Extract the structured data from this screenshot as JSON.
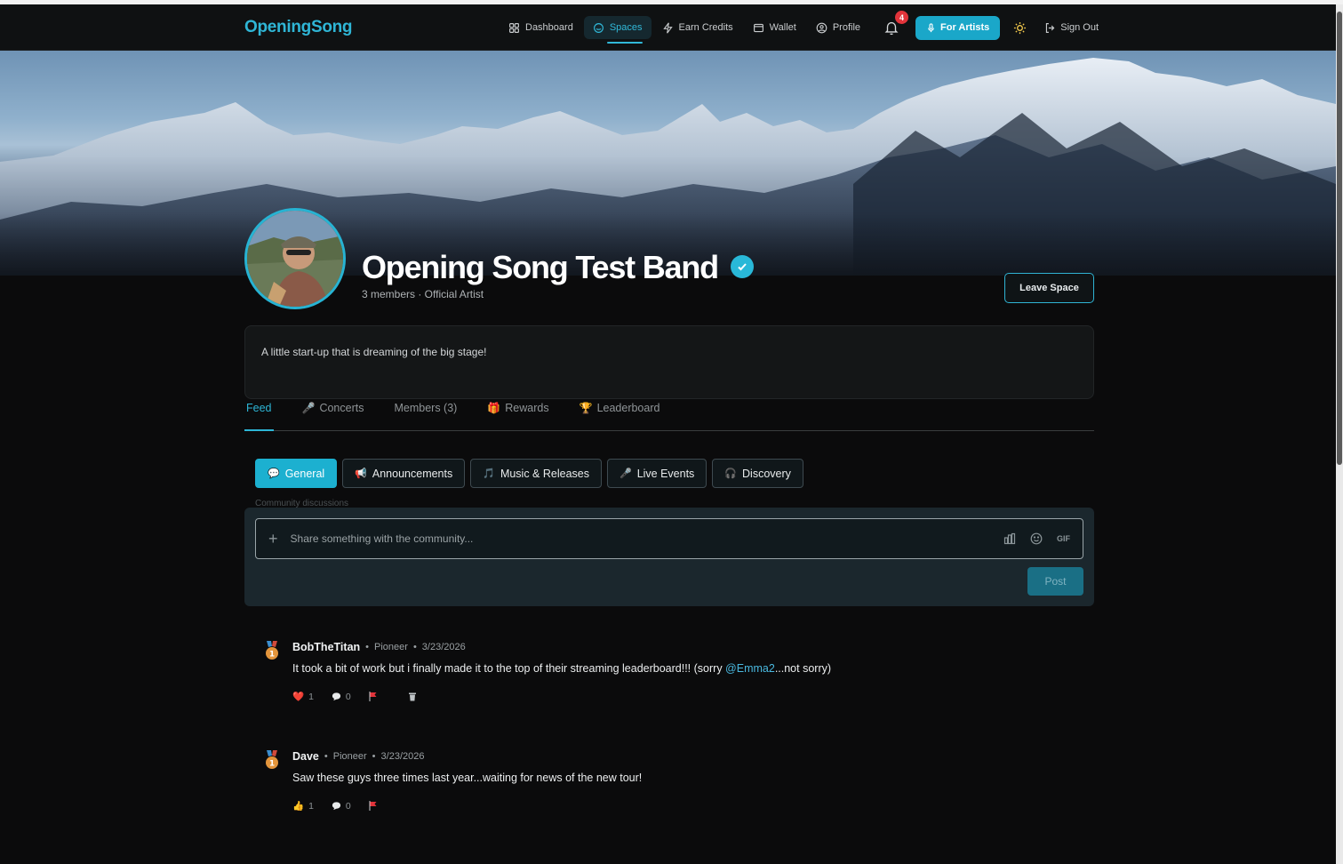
{
  "app": {
    "logo": "OpeningSong"
  },
  "nav": {
    "items": [
      {
        "label": "Dashboard",
        "icon": "grid-icon"
      },
      {
        "label": "Spaces",
        "icon": "spaces-icon",
        "active": true
      },
      {
        "label": "Earn Credits",
        "icon": "bolt-icon"
      },
      {
        "label": "Wallet",
        "icon": "wallet-icon"
      },
      {
        "label": "Profile",
        "icon": "user-circle-icon"
      }
    ],
    "notifications_count": "4",
    "for_artists_label": "For Artists",
    "sign_out_label": "Sign Out"
  },
  "space": {
    "name": "Opening Song Test Band",
    "meta": "3 members · Official Artist",
    "leave_label": "Leave Space",
    "description": "A little start-up that is dreaming of the big stage!"
  },
  "tabs": [
    {
      "label": "Feed",
      "icon": ""
    },
    {
      "label": "Concerts",
      "icon": "🎤"
    },
    {
      "label": "Members (3)",
      "icon": ""
    },
    {
      "label": "Rewards",
      "icon": "🎁"
    },
    {
      "label": "Leaderboard",
      "icon": "🏆"
    }
  ],
  "channels": [
    {
      "label": "General",
      "icon": "💬"
    },
    {
      "label": "Announcements",
      "icon": "📢"
    },
    {
      "label": "Music & Releases",
      "icon": "🎵"
    },
    {
      "label": "Live Events",
      "icon": "🎤"
    },
    {
      "label": "Discovery",
      "icon": "🎧"
    }
  ],
  "channel_caption": "Community discussions",
  "composer": {
    "placeholder": "Share something with the community...",
    "gif_label": "GIF",
    "post_label": "Post"
  },
  "posts": [
    {
      "author": "BobTheTitan",
      "rank": "Pioneer",
      "date": "3/23/2026",
      "text_before": "It took a bit of work but i finally made it to the top of their streaming leaderboard!!! (sorry ",
      "mention": "@Emma2",
      "text_after": "...not sorry)",
      "reaction_icon": "❤️",
      "reaction_count": "1",
      "comment_count": "0"
    },
    {
      "author": "Dave",
      "rank": "Pioneer",
      "date": "3/23/2026",
      "text_before": "Saw these guys three times last year...waiting for news of the new tour!",
      "mention": "",
      "text_after": "",
      "reaction_icon": "👍",
      "reaction_count": "1",
      "comment_count": "0"
    }
  ],
  "colors": {
    "accent": "#1cb0d0",
    "background": "#0b0b0c",
    "badge": "#e2343b"
  }
}
